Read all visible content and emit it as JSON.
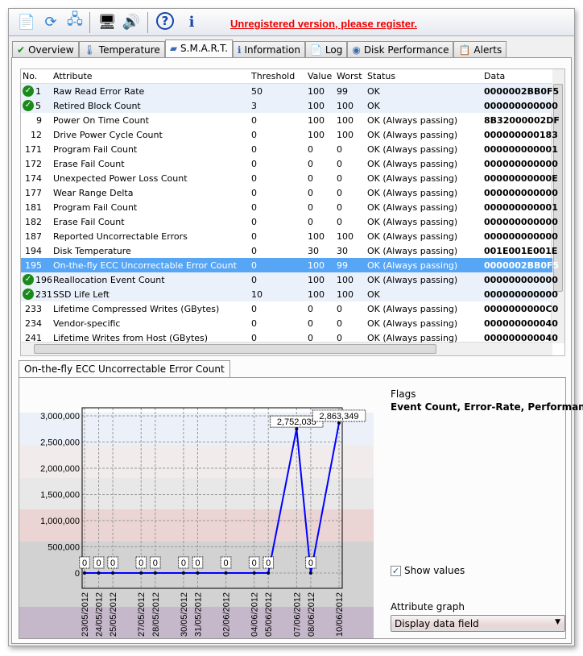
{
  "toolbar": {
    "icons": [
      "report-icon",
      "refresh-icon",
      "network-icon",
      "settings-icon",
      "sound-icon",
      "help-icon",
      "info-icon"
    ],
    "register_text": "Unregistered version, please register."
  },
  "tabs": [
    {
      "label": "Overview",
      "icon": "check-icon"
    },
    {
      "label": "Temperature",
      "icon": "thermometer-icon"
    },
    {
      "label": "S.M.A.R.T.",
      "icon": "disk-icon"
    },
    {
      "label": "Information",
      "icon": "info-icon"
    },
    {
      "label": "Log",
      "icon": "log-icon"
    },
    {
      "label": "Disk Performance",
      "icon": "gauge-icon"
    },
    {
      "label": "Alerts",
      "icon": "alerts-icon"
    }
  ],
  "active_tab": "S.M.A.R.T.",
  "table": {
    "columns": [
      "No.",
      "Attribute",
      "Threshold",
      "Value",
      "Worst",
      "Status",
      "Data"
    ],
    "rows": [
      [
        "1",
        "Raw Read Error Rate",
        "50",
        "100",
        "99",
        "OK",
        "0000002BB0F5",
        "hl"
      ],
      [
        "5",
        "Retired Block Count",
        "3",
        "100",
        "100",
        "OK",
        "000000000000",
        "hl"
      ],
      [
        "9",
        "Power On Time Count",
        "0",
        "100",
        "100",
        "OK (Always passing)",
        "8B32000002DF",
        ""
      ],
      [
        "12",
        "Drive Power Cycle Count",
        "0",
        "100",
        "100",
        "OK (Always passing)",
        "000000000183",
        ""
      ],
      [
        "171",
        "Program Fail Count",
        "0",
        "0",
        "0",
        "OK (Always passing)",
        "000000000001",
        ""
      ],
      [
        "172",
        "Erase Fail Count",
        "0",
        "0",
        "0",
        "OK (Always passing)",
        "000000000000",
        ""
      ],
      [
        "174",
        "Unexpected Power Loss Count",
        "0",
        "0",
        "0",
        "OK (Always passing)",
        "00000000000E",
        ""
      ],
      [
        "177",
        "Wear Range Delta",
        "0",
        "0",
        "0",
        "OK (Always passing)",
        "000000000000",
        ""
      ],
      [
        "181",
        "Program Fail Count",
        "0",
        "0",
        "0",
        "OK (Always passing)",
        "000000000001",
        ""
      ],
      [
        "182",
        "Erase Fail Count",
        "0",
        "0",
        "0",
        "OK (Always passing)",
        "000000000000",
        ""
      ],
      [
        "187",
        "Reported Uncorrectable Errors",
        "0",
        "100",
        "100",
        "OK (Always passing)",
        "000000000000",
        ""
      ],
      [
        "194",
        "Disk Temperature",
        "0",
        "30",
        "30",
        "OK (Always passing)",
        "001E001E001E",
        ""
      ],
      [
        "195",
        "On-the-fly ECC Uncorrectable Error Count",
        "0",
        "100",
        "99",
        "OK (Always passing)",
        "0000002BB0F5",
        "sel"
      ],
      [
        "196",
        "Reallocation Event Count",
        "0",
        "100",
        "100",
        "OK (Always passing)",
        "000000000000",
        "hl"
      ],
      [
        "231",
        "SSD Life Left",
        "10",
        "100",
        "100",
        "OK",
        "000000000000",
        "hl"
      ],
      [
        "233",
        "Lifetime Compressed Writes (GBytes)",
        "0",
        "0",
        "0",
        "OK (Always passing)",
        "0000000000C0",
        ""
      ],
      [
        "234",
        "Vendor-specific",
        "0",
        "0",
        "0",
        "OK (Always passing)",
        "000000000040",
        ""
      ],
      [
        "241",
        "Lifetime Writes from Host (GBytes)",
        "0",
        "0",
        "0",
        "OK (Always passing)",
        "000000000040",
        ""
      ]
    ]
  },
  "detail": {
    "tab_label": "On-the-fly ECC Uncorrectable Error Count",
    "flags_label": "Flags",
    "flags_value": "Event Count, Error-Rate, Performance",
    "show_values_label": "Show values",
    "show_values_checked": true,
    "attribute_graph_label": "Attribute graph",
    "attribute_graph_value": "Display data field"
  },
  "chart_data": {
    "type": "line",
    "color": "#0000ff",
    "x": [
      "23/05/2012",
      "24/05/2012",
      "25/05/2012",
      "27/05/2012",
      "28/05/2012",
      "30/05/2012",
      "31/05/2012",
      "02/06/2012",
      "04/06/2012",
      "05/06/2012",
      "07/06/2012",
      "08/06/2012",
      "10/06/2012"
    ],
    "values": [
      0,
      0,
      0,
      0,
      0,
      0,
      0,
      0,
      0,
      0,
      2752035,
      0,
      2863349
    ],
    "value_labels": [
      "0",
      "0",
      "0",
      "0",
      "0",
      "0",
      "0",
      "0",
      "0",
      "0",
      "2,752,035",
      "0",
      "2,863,349"
    ],
    "yticks": [
      "0",
      "500,000",
      "1,000,000",
      "1,500,000",
      "2,000,000",
      "2,500,000",
      "3,000,000"
    ],
    "ytick_values": [
      0,
      500000,
      1000000,
      1500000,
      2000000,
      2500000,
      3000000
    ],
    "xlim": [
      "23/05/2012",
      "10/06/2012"
    ],
    "grid": true,
    "band_colors": [
      "#ecf1f9",
      "#f1ebeb",
      "#e8e8e8",
      "#ebd5d4",
      "#d2d2d2",
      "#c6b8cb"
    ]
  }
}
